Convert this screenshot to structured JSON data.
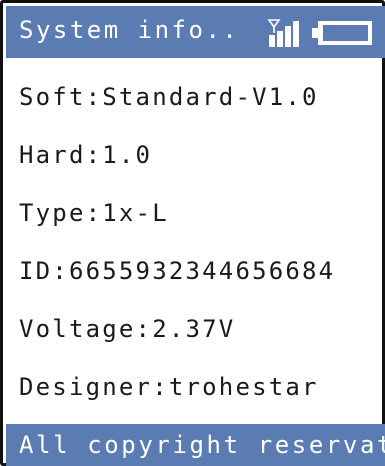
{
  "header": {
    "title": "System info..",
    "signal_icon": "signal-bars-icon",
    "battery_icon": "battery-icon"
  },
  "info": {
    "soft": "Soft:Standard-V1.0",
    "hard": "Hard:1.0",
    "type": "Type:1x-L",
    "id": "ID:6655932344656684",
    "voltage": "Voltage:2.37V",
    "designer": "Designer:trohestar"
  },
  "footer": {
    "text": "All copyright reservat"
  },
  "colors": {
    "bar": "#5b7bb3",
    "text": "#1a1a1a",
    "bar_text": "#ffffff"
  }
}
